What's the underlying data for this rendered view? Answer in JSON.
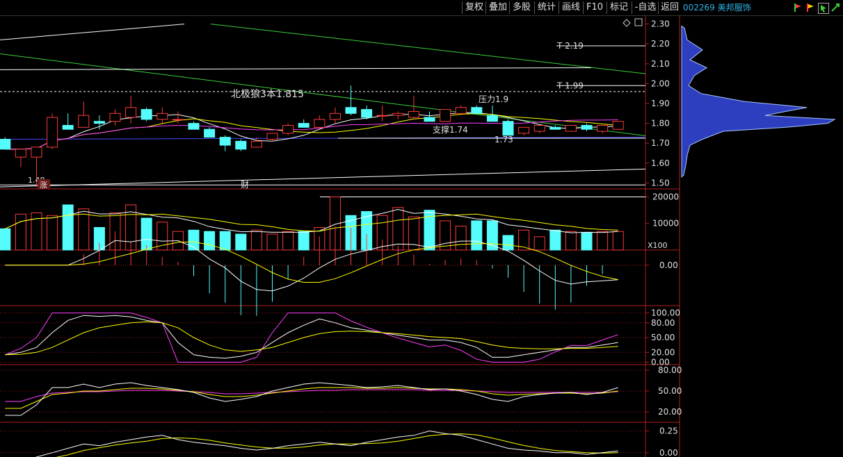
{
  "toolbar": {
    "buttons": [
      "复权",
      "叠加",
      "多股",
      "统计",
      "画线",
      "F10",
      "标记",
      "-自选",
      "返回"
    ],
    "stock_code": "002269",
    "stock_name": "美邦服饰"
  },
  "colors": {
    "up": "#ff3a3a",
    "down": "#54fcfc",
    "axis": "#b02020",
    "label": "#e0e0e0",
    "white_line": "#ffffff",
    "yellow_line": "#ffff00",
    "magenta_line": "#ff40ff",
    "green_line": "#3ad03a",
    "blue_line": "#4a4aff"
  },
  "chart_data": [
    {
      "type": "candlestick",
      "panel": "price",
      "y_ticks": [
        "2.30",
        "2.20",
        "2.10",
        "2.00",
        "1.90",
        "1.80",
        "1.70",
        "1.60",
        "1.50"
      ],
      "ylim": [
        1.47,
        2.33
      ],
      "annotations": {
        "t_high": "T 2.19",
        "t_mid": "T 1.99",
        "title": "北极狼3本1.815",
        "pressure": "压力1.9",
        "support": "支撑1.74",
        "low_mark": "1.73",
        "left_low": "1.48",
        "tag_zhang": "涨",
        "tag_cai": "财"
      },
      "candles": [
        {
          "o": 1.72,
          "h": 1.73,
          "l": 1.67,
          "c": 1.67
        },
        {
          "o": 1.63,
          "h": 1.67,
          "l": 1.58,
          "c": 1.67
        },
        {
          "o": 1.63,
          "h": 1.67,
          "l": 1.48,
          "c": 1.68
        },
        {
          "o": 1.68,
          "h": 1.85,
          "l": 1.67,
          "c": 1.83
        },
        {
          "o": 1.79,
          "h": 1.85,
          "l": 1.77,
          "c": 1.77
        },
        {
          "o": 1.78,
          "h": 1.91,
          "l": 1.78,
          "c": 1.84
        },
        {
          "o": 1.81,
          "h": 1.84,
          "l": 1.77,
          "c": 1.8
        },
        {
          "o": 1.81,
          "h": 1.87,
          "l": 1.79,
          "c": 1.85
        },
        {
          "o": 1.83,
          "h": 1.94,
          "l": 1.8,
          "c": 1.88
        },
        {
          "o": 1.87,
          "h": 1.88,
          "l": 1.81,
          "c": 1.82
        },
        {
          "o": 1.82,
          "h": 1.88,
          "l": 1.8,
          "c": 1.85
        },
        {
          "o": 1.82,
          "h": 1.86,
          "l": 1.8,
          "c": 1.82
        },
        {
          "o": 1.8,
          "h": 1.81,
          "l": 1.77,
          "c": 1.77
        },
        {
          "o": 1.77,
          "h": 1.78,
          "l": 1.73,
          "c": 1.73
        },
        {
          "o": 1.73,
          "h": 1.74,
          "l": 1.66,
          "c": 1.69
        },
        {
          "o": 1.71,
          "h": 1.72,
          "l": 1.66,
          "c": 1.67
        },
        {
          "o": 1.68,
          "h": 1.73,
          "l": 1.68,
          "c": 1.71
        },
        {
          "o": 1.72,
          "h": 1.75,
          "l": 1.71,
          "c": 1.75
        },
        {
          "o": 1.75,
          "h": 1.8,
          "l": 1.74,
          "c": 1.79
        },
        {
          "o": 1.8,
          "h": 1.82,
          "l": 1.78,
          "c": 1.78
        },
        {
          "o": 1.78,
          "h": 1.84,
          "l": 1.77,
          "c": 1.82
        },
        {
          "o": 1.82,
          "h": 1.88,
          "l": 1.8,
          "c": 1.85
        },
        {
          "o": 1.88,
          "h": 1.99,
          "l": 1.84,
          "c": 1.85
        },
        {
          "o": 1.87,
          "h": 1.89,
          "l": 1.82,
          "c": 1.83
        },
        {
          "o": 1.84,
          "h": 1.89,
          "l": 1.81,
          "c": 1.84
        },
        {
          "o": 1.84,
          "h": 1.86,
          "l": 1.82,
          "c": 1.85
        },
        {
          "o": 1.83,
          "h": 1.94,
          "l": 1.82,
          "c": 1.86
        },
        {
          "o": 1.83,
          "h": 1.86,
          "l": 1.81,
          "c": 1.81
        },
        {
          "o": 1.81,
          "h": 1.87,
          "l": 1.81,
          "c": 1.87
        },
        {
          "o": 1.85,
          "h": 1.89,
          "l": 1.84,
          "c": 1.88
        },
        {
          "o": 1.88,
          "h": 1.89,
          "l": 1.85,
          "c": 1.85
        },
        {
          "o": 1.84,
          "h": 1.89,
          "l": 1.81,
          "c": 1.81
        },
        {
          "o": 1.81,
          "h": 1.82,
          "l": 1.74,
          "c": 1.74
        },
        {
          "o": 1.75,
          "h": 1.78,
          "l": 1.74,
          "c": 1.78
        },
        {
          "o": 1.76,
          "h": 1.79,
          "l": 1.75,
          "c": 1.79
        },
        {
          "o": 1.78,
          "h": 1.79,
          "l": 1.77,
          "c": 1.77
        },
        {
          "o": 1.76,
          "h": 1.79,
          "l": 1.76,
          "c": 1.79
        },
        {
          "o": 1.79,
          "h": 1.8,
          "l": 1.76,
          "c": 1.77
        },
        {
          "o": 1.76,
          "h": 1.79,
          "l": 1.75,
          "c": 1.79
        },
        {
          "o": 1.77,
          "h": 1.81,
          "l": 1.77,
          "c": 1.81
        }
      ]
    },
    {
      "type": "bar",
      "panel": "volume",
      "y_ticks": [
        "20000",
        "10000"
      ],
      "unit_label": "X100",
      "ylim": [
        0,
        23000
      ],
      "values": [
        8000,
        13500,
        14000,
        13000,
        17000,
        15500,
        8500,
        14000,
        17000,
        12000,
        10500,
        7000,
        7500,
        7000,
        7000,
        6000,
        7500,
        6000,
        7000,
        7000,
        8500,
        20000,
        13000,
        14500,
        13000,
        16000,
        12500,
        15000,
        11000,
        9000,
        11000,
        11000,
        5500,
        7500,
        5000,
        7500,
        7000,
        6500,
        7000,
        7000
      ]
    },
    {
      "type": "line",
      "panel": "macd",
      "y_ticks": [
        "0.00"
      ],
      "ylim": [
        -0.08,
        0.03
      ]
    },
    {
      "type": "line",
      "panel": "kdj",
      "y_ticks": [
        "100.00",
        "80.00",
        "50.00",
        "20.00",
        "0.00"
      ],
      "ylim": [
        -5,
        115
      ]
    },
    {
      "type": "line",
      "panel": "rsi",
      "y_ticks": [
        "80.00",
        "50.00",
        "20.00"
      ],
      "ylim": [
        5,
        88
      ]
    },
    {
      "type": "line",
      "panel": "osc",
      "y_ticks": [
        "0.25",
        "0.00"
      ],
      "ylim": [
        -0.05,
        0.35
      ]
    }
  ]
}
